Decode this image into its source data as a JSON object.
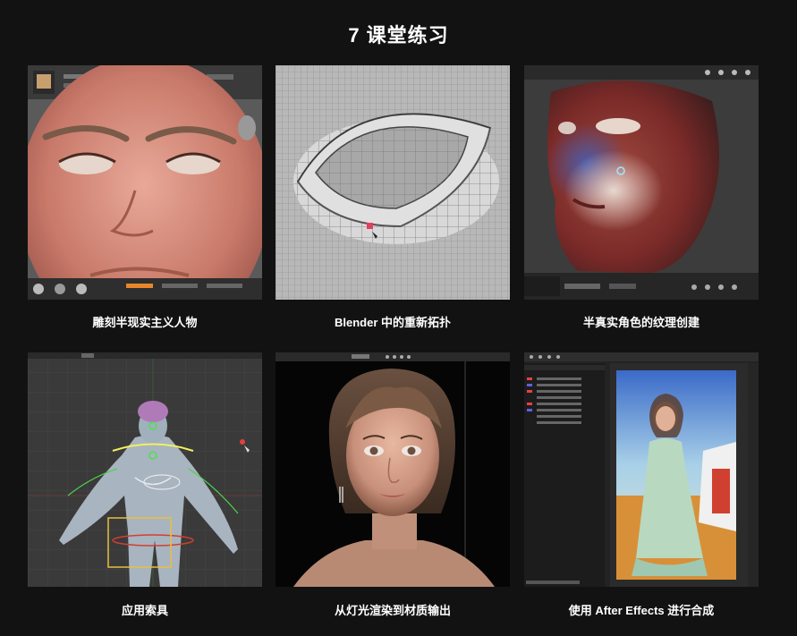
{
  "page": {
    "title": "7 课堂练习"
  },
  "lessons": [
    {
      "caption": "雕刻半现实主义人物",
      "icon": "zbrush-sculpt-face"
    },
    {
      "caption": "Blender 中的重新拓扑",
      "icon": "retopology-wireframe-eye"
    },
    {
      "caption": "半真实角色的纹理创建",
      "icon": "texture-painting-face"
    },
    {
      "caption": "应用索具",
      "icon": "character-rig"
    },
    {
      "caption": "从灯光渲染到材质输出",
      "icon": "rendered-portrait"
    },
    {
      "caption": "使用 After Effects 进行合成",
      "icon": "after-effects-composite"
    }
  ],
  "colors": {
    "background": "#121212",
    "text": "#ffffff",
    "accent": "#e8862a"
  }
}
